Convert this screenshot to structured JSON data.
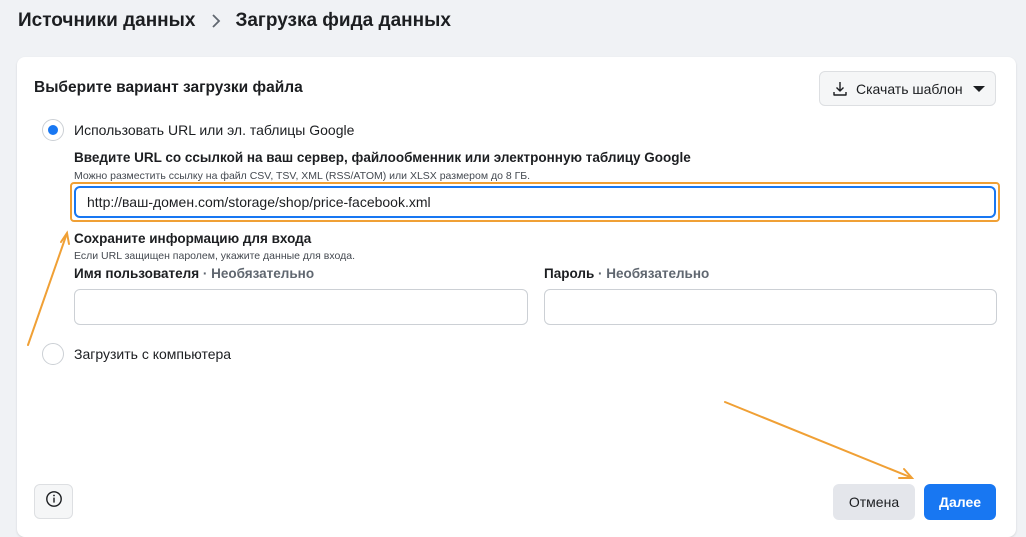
{
  "breadcrumb": {
    "parent": "Источники данных",
    "current": "Загрузка фида данных"
  },
  "card": {
    "title": "Выберите вариант загрузки файла",
    "download_template_label": "Скачать шаблон"
  },
  "options": {
    "url_option_label": "Использовать URL или эл. таблицы Google",
    "url_option_selected": true,
    "computer_option_label": "Загрузить с компьютера",
    "computer_option_selected": false
  },
  "url_field": {
    "title": "Введите URL со ссылкой на ваш сервер, файлообменник или электронную таблицу Google",
    "hint": "Можно разместить ссылку на файл CSV, TSV, XML (RSS/ATOM) или XLSX размером до 8 ГБ.",
    "value": "http://ваш-домен.com/storage/shop/price-facebook.xml"
  },
  "login": {
    "title": "Сохраните информацию для входа",
    "hint": "Если URL защищен паролем, укажите данные для входа.",
    "username_label": "Имя пользователя",
    "password_label": "Пароль",
    "optional_suffix": " · Необязательно",
    "username_value": "",
    "password_value": ""
  },
  "footer": {
    "cancel_label": "Отмена",
    "next_label": "Далее"
  },
  "colors": {
    "accent": "#1877f2",
    "highlight": "#f0a035"
  },
  "icons": [
    "chevron-right-icon",
    "download-icon",
    "caret-down-icon",
    "info-icon",
    "annotation-arrow"
  ]
}
